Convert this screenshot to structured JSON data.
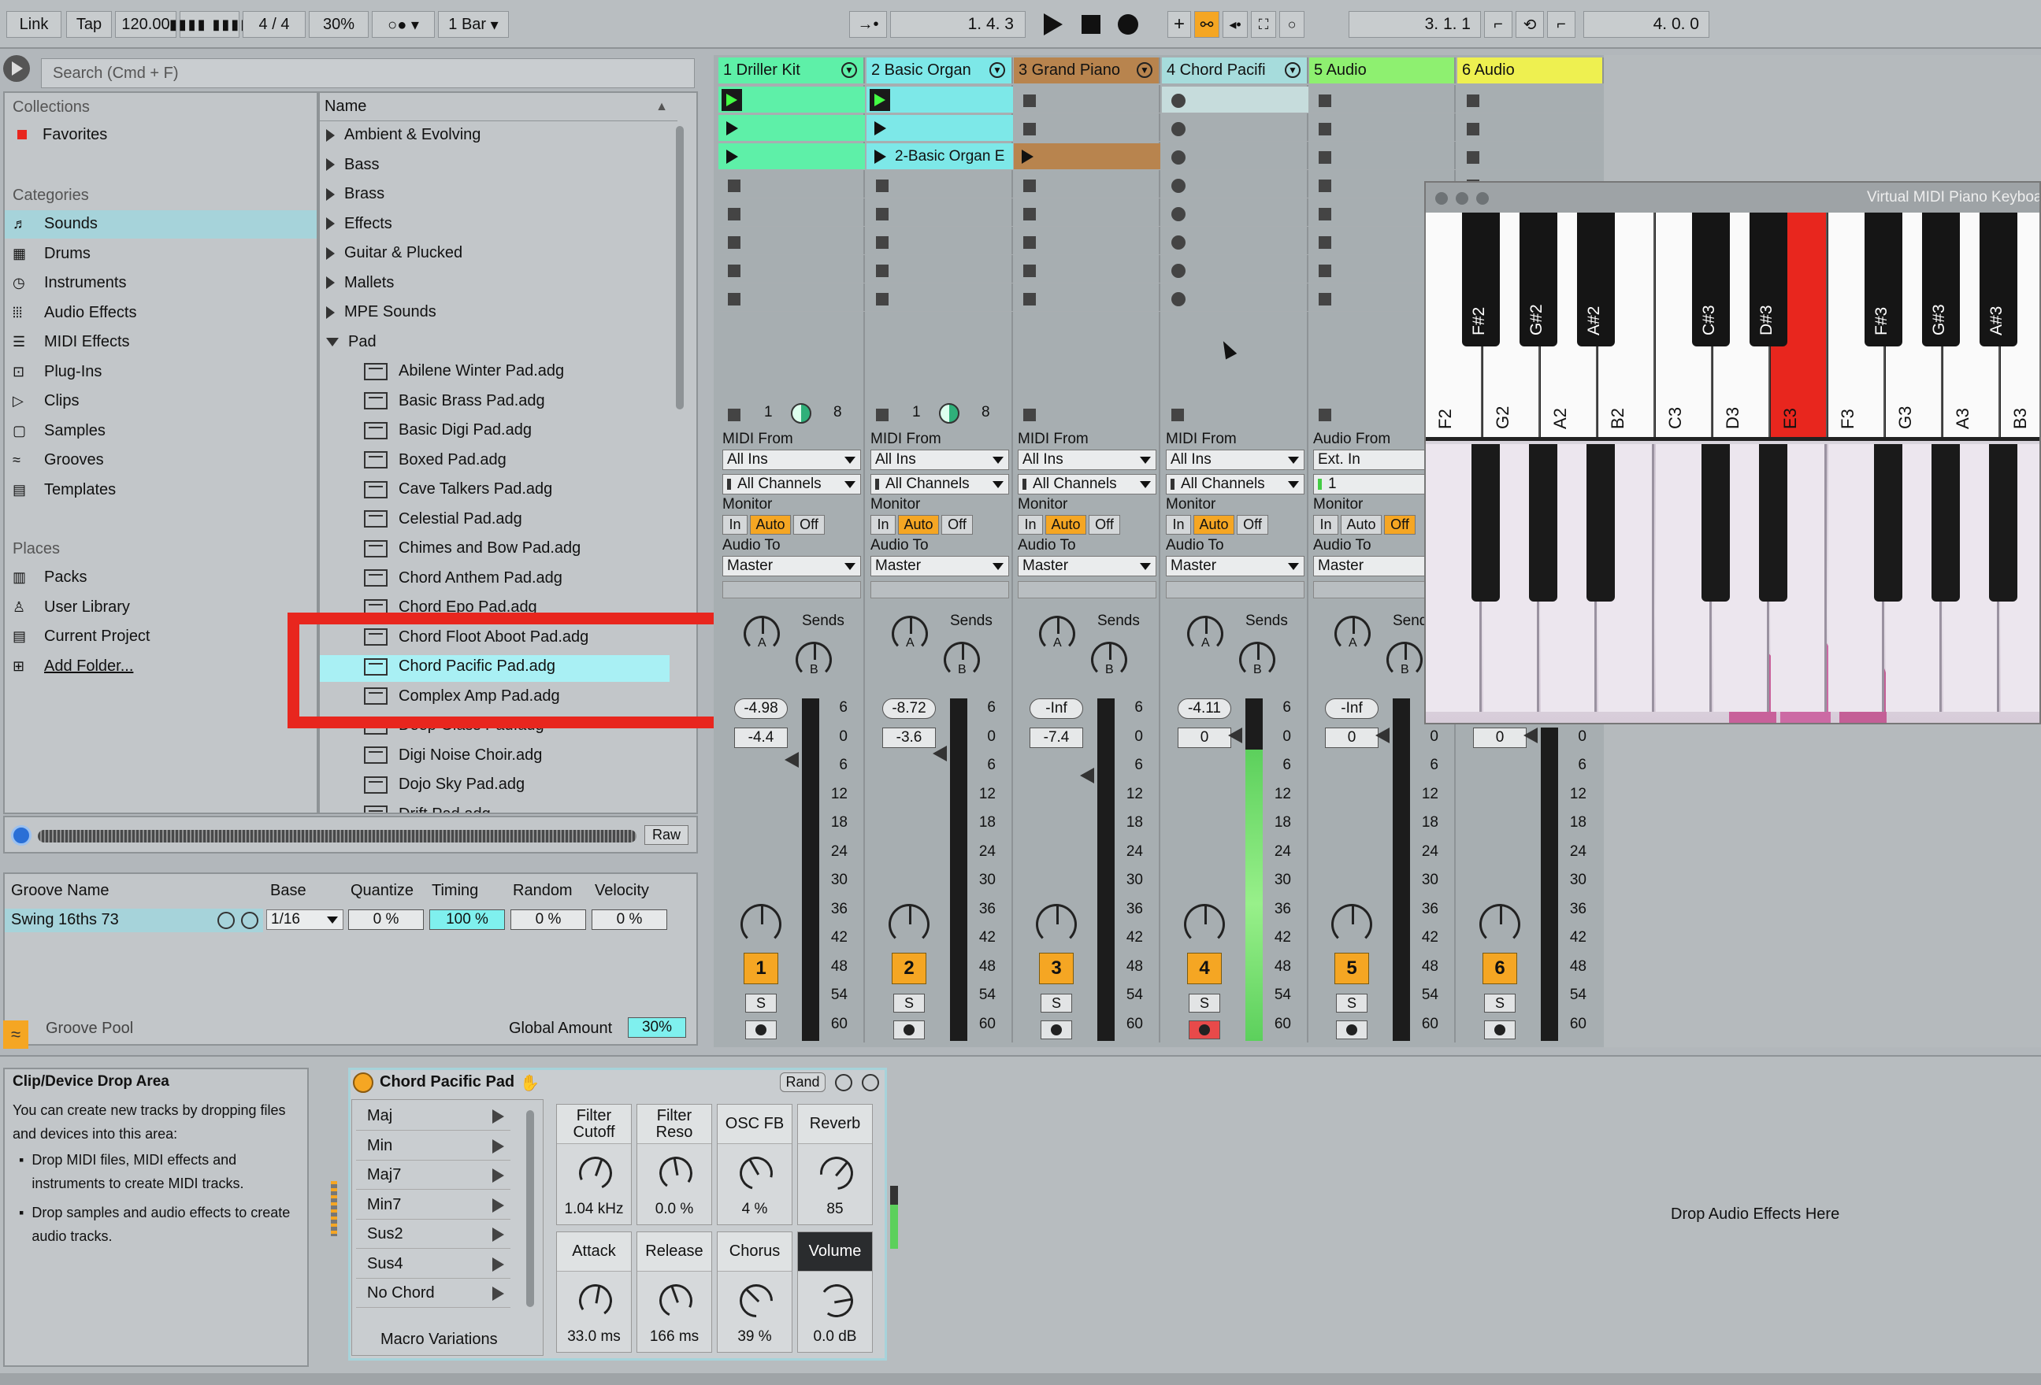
{
  "toolbar": {
    "link": "Link",
    "tap": "Tap",
    "tempo": "120.00",
    "time_signature": "4 / 4",
    "metronome_percent": "30%",
    "quantize": "1 Bar",
    "arrangement_position": "1.   4.   3",
    "punch_position": "3.   1.   1",
    "loop_length": "4.   0.   0"
  },
  "browser": {
    "search_placeholder": "Search (Cmd + F)",
    "collections_header": "Collections",
    "favorites": "Favorites",
    "categories_header": "Categories",
    "categories": [
      "Sounds",
      "Drums",
      "Instruments",
      "Audio Effects",
      "MIDI Effects",
      "Plug-Ins",
      "Clips",
      "Samples",
      "Grooves",
      "Templates"
    ],
    "places_header": "Places",
    "places": [
      "Packs",
      "User Library",
      "Current Project",
      "Add Folder..."
    ],
    "name_header": "Name",
    "folders": [
      "Ambient & Evolving",
      "Bass",
      "Brass",
      "Effects",
      "Guitar & Plucked",
      "Mallets",
      "MPE Sounds",
      "Pad"
    ],
    "files": [
      "Abilene Winter Pad.adg",
      "Basic Brass Pad.adg",
      "Basic Digi Pad.adg",
      "Boxed Pad.adg",
      "Cave Talkers Pad.adg",
      "Celestial Pad.adg",
      "Chimes and Bow Pad.adg",
      "Chord Anthem Pad.adg",
      "Chord Epo Pad.adg",
      "Chord Floot Aboot Pad.adg",
      "Chord Pacific Pad.adg",
      "Complex Amp Pad.adg",
      "Deep Glass Pad.adg",
      "Digi Noise Choir.adg",
      "Dojo Sky Pad.adg",
      "Drift Pad.adg"
    ],
    "selected_file": "Chord Pacific Pad.adg",
    "raw_button": "Raw"
  },
  "groove": {
    "headers": [
      "Groove Name",
      "Base",
      "Quantize",
      "Timing",
      "Random",
      "Velocity"
    ],
    "name": "Swing 16ths 73",
    "base": "1/16",
    "quantize": "0 %",
    "timing": "100 %",
    "random": "0 %",
    "velocity": "0 %",
    "pool_label": "Groove Pool",
    "global_amount_label": "Global Amount",
    "global_amount": "30%"
  },
  "tracks": [
    {
      "name": "1 Driller Kit",
      "color": "#5ef0a8",
      "num": "1",
      "from_label": "MIDI From",
      "from": "All Ins",
      "ch": "All Channels",
      "pan": "-4.98",
      "vol": "-4.4"
    },
    {
      "name": "2 Basic Organ",
      "color": "#7de8e8",
      "num": "2",
      "from_label": "MIDI From",
      "from": "All Ins",
      "ch": "All Channels",
      "pan": "-8.72",
      "vol": "-3.6",
      "clip": "2-Basic Organ E"
    },
    {
      "name": "3 Grand Piano",
      "color": "#b8844e",
      "num": "3",
      "from_label": "MIDI From",
      "from": "All Ins",
      "ch": "All Channels",
      "pan": "-Inf",
      "vol": "-7.4"
    },
    {
      "name": "4 Chord Pacifi",
      "color": "#a6dcdc",
      "num": "4",
      "from_label": "MIDI From",
      "from": "All Ins",
      "ch": "All Channels",
      "pan": "-4.11",
      "vol": "0"
    },
    {
      "name": "5 Audio",
      "color": "#8ef070",
      "num": "5",
      "from_label": "Audio From",
      "from": "Ext. In",
      "ch": "1",
      "pan": "-Inf",
      "vol": "0"
    },
    {
      "name": "6 Audio",
      "color": "#eef050",
      "num": "6",
      "vol": "0"
    }
  ],
  "mixer": {
    "monitor_label": "Monitor",
    "in": "In",
    "auto": "Auto",
    "off": "Off",
    "audio_to_label": "Audio To",
    "master": "Master",
    "sends": "Sends",
    "send_a": "A",
    "send_b": "B",
    "solo": "S",
    "scale": [
      "6",
      "0",
      "6",
      "12",
      "18",
      "24",
      "30",
      "36",
      "42",
      "48",
      "54",
      "60"
    ],
    "stop_clip_numbers": [
      "1",
      "8"
    ]
  },
  "piano": {
    "title": "Virtual MIDI Piano Keyboard",
    "white_keys": [
      "F2",
      "G2",
      "A2",
      "B2",
      "C3",
      "D3",
      "E3",
      "F3",
      "G3",
      "A3",
      "B3"
    ],
    "black_keys": [
      "F#2",
      "G#2",
      "A#2",
      "C#3",
      "D#3",
      "F#3",
      "G#3",
      "A#3"
    ],
    "active_key": "E3",
    "active_color": "#e8261e"
  },
  "drop_area": {
    "title": "Clip/Device Drop Area",
    "intro": "You can create new tracks by dropping files and devices into this area:",
    "bullets": [
      "Drop MIDI files, MIDI effects and instruments to create MIDI tracks.",
      "Drop samples and audio effects to create audio tracks."
    ],
    "audio_effects": "Drop Audio Effects Here"
  },
  "device": {
    "title": "Chord Pacific Pad",
    "rand": "Rand",
    "variations": [
      "Maj",
      "Min",
      "Maj7",
      "Min7",
      "Sus2",
      "Sus4",
      "No Chord"
    ],
    "variations_label": "Macro Variations",
    "macros": [
      {
        "label": "Filter\nCutoff",
        "value": "1.04 kHz"
      },
      {
        "label": "Filter\nReso",
        "value": "0.0 %"
      },
      {
        "label": "OSC FB",
        "value": "4 %"
      },
      {
        "label": "Reverb",
        "value": "85"
      },
      {
        "label": "Attack",
        "value": "33.0 ms"
      },
      {
        "label": "Release",
        "value": "166 ms"
      },
      {
        "label": "Chorus",
        "value": "39 %"
      },
      {
        "label": "Volume",
        "value": "0.0 dB"
      }
    ]
  },
  "highlight_color": "#e8261e",
  "accent_orange": "#f5a623"
}
